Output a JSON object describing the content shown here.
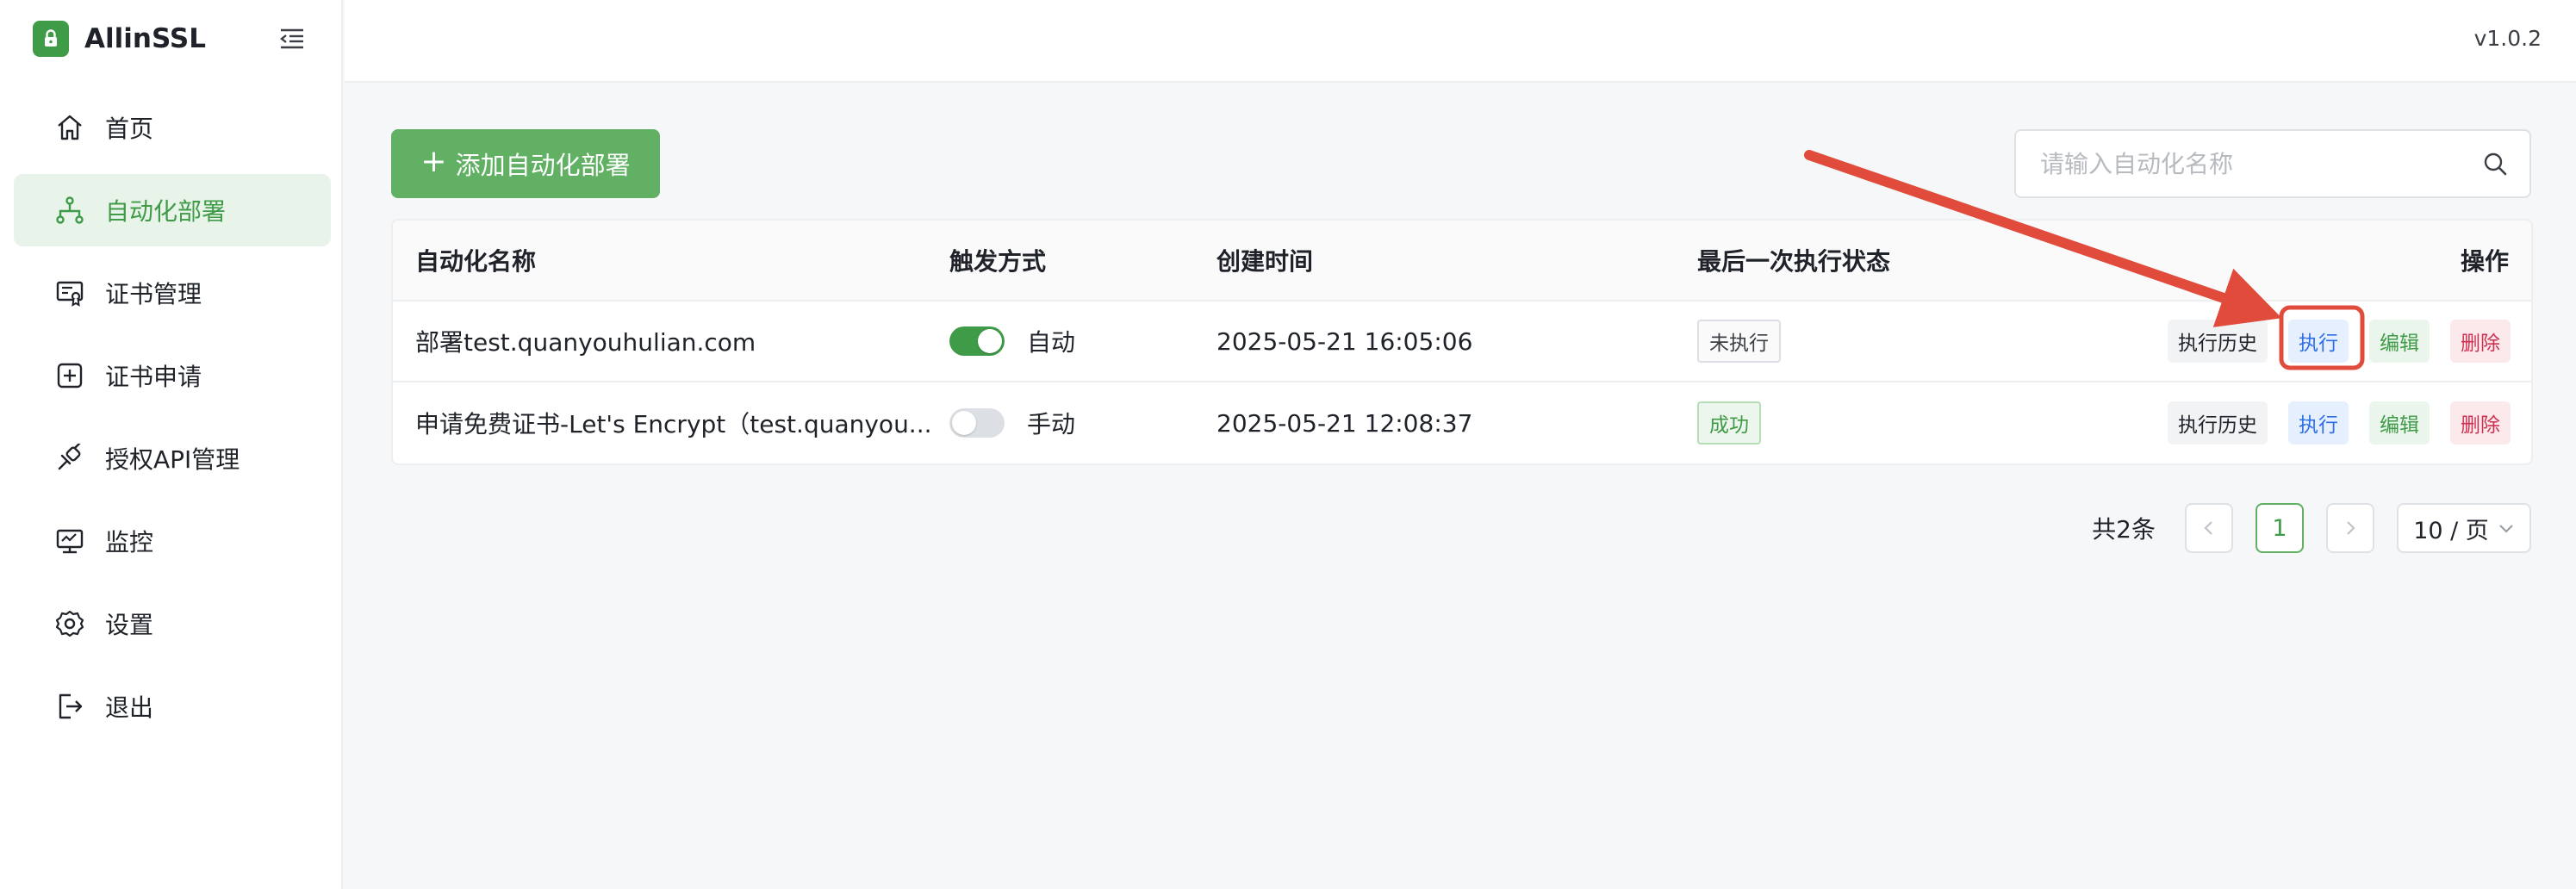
{
  "brand": {
    "name": "AllinSSL",
    "logo_text": "AllinSSL"
  },
  "header": {
    "version": "v1.0.2"
  },
  "sidebar": {
    "items": [
      {
        "label": "首页",
        "icon": "home-icon",
        "active": false
      },
      {
        "label": "自动化部署",
        "icon": "workflow-icon",
        "active": true
      },
      {
        "label": "证书管理",
        "icon": "certificate-icon",
        "active": false
      },
      {
        "label": "证书申请",
        "icon": "plus-square-icon",
        "active": false
      },
      {
        "label": "授权API管理",
        "icon": "api-plug-icon",
        "active": false
      },
      {
        "label": "监控",
        "icon": "monitor-icon",
        "active": false
      },
      {
        "label": "设置",
        "icon": "gear-icon",
        "active": false
      },
      {
        "label": "退出",
        "icon": "logout-icon",
        "active": false
      }
    ]
  },
  "toolbar": {
    "add_label": "添加自动化部署",
    "search_placeholder": "请输入自动化名称",
    "search_value": ""
  },
  "table": {
    "columns": {
      "name": "自动化名称",
      "trigger": "触发方式",
      "created": "创建时间",
      "status": "最后一次执行状态",
      "actions": "操作"
    },
    "rows": [
      {
        "name": "部署test.quanyouhulian.com",
        "trigger_on": true,
        "trigger_label": "自动",
        "created": "2025-05-21 16:05:06",
        "status": "未执行",
        "status_kind": "pending",
        "actions": {
          "history": "执行历史",
          "run": "执行",
          "edit": "编辑",
          "delete": "删除"
        }
      },
      {
        "name": "申请免费证书-Let's Encrypt（test.quanyou...",
        "trigger_on": false,
        "trigger_label": "手动",
        "created": "2025-05-21 12:08:37",
        "status": "成功",
        "status_kind": "success",
        "actions": {
          "history": "执行历史",
          "run": "执行",
          "edit": "编辑",
          "delete": "删除"
        }
      }
    ]
  },
  "pagination": {
    "total": "共2条",
    "current_page": "1",
    "page_size": "10 / 页"
  },
  "colors": {
    "brand_green": "#3f9b48",
    "button_green": "#61b064",
    "annotation_red": "#e04b3c"
  }
}
